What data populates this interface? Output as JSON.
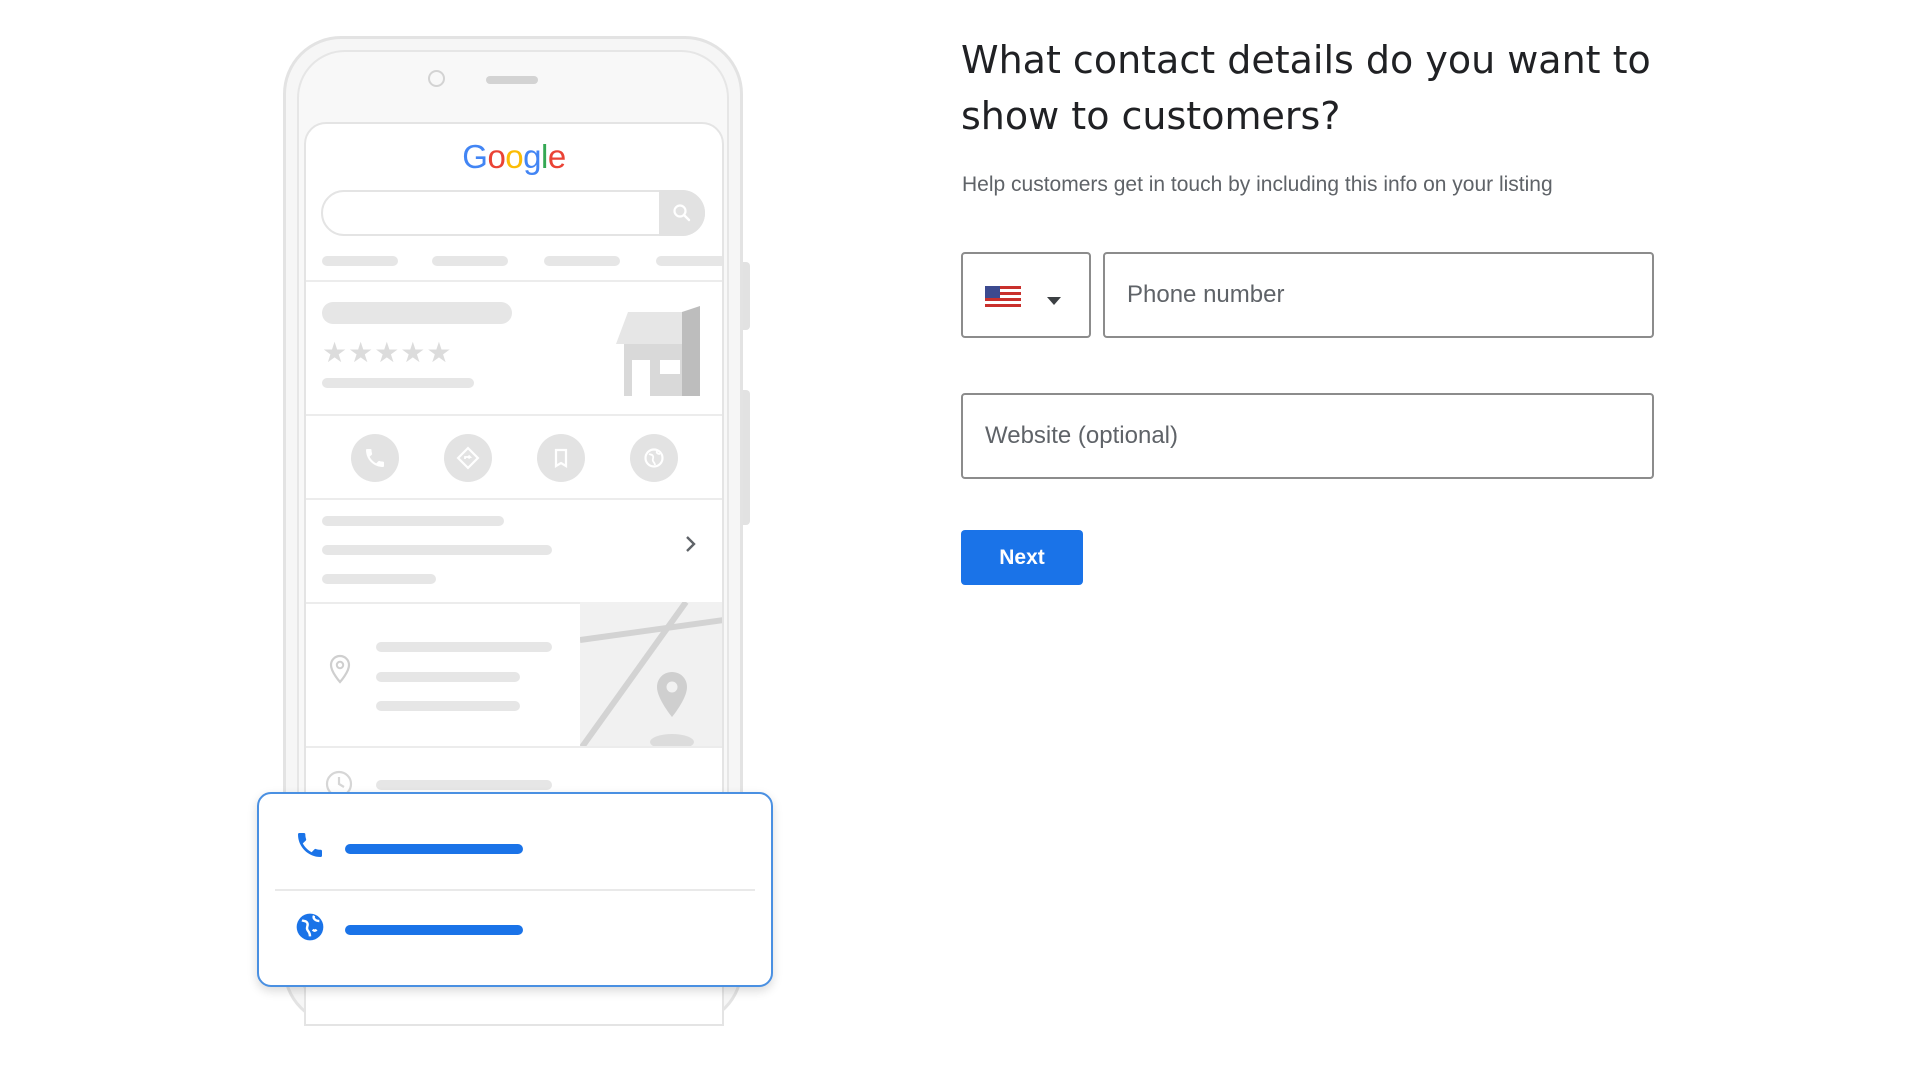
{
  "form": {
    "title": "What contact details do you want to show to customers?",
    "subtitle": "Help customers get in touch by including this info on your listing",
    "country_select": {
      "flag_icon": "us-flag-icon",
      "dropdown_icon": "caret-down-icon"
    },
    "phone_placeholder": "Phone number",
    "website_placeholder": "Website (optional)",
    "next_label": "Next"
  },
  "illustration": {
    "logo_letters": [
      {
        "char": "G",
        "color": "#4285F4"
      },
      {
        "char": "o",
        "color": "#EA4335"
      },
      {
        "char": "o",
        "color": "#FBBC05"
      },
      {
        "char": "g",
        "color": "#4285F4"
      },
      {
        "char": "l",
        "color": "#34A853"
      },
      {
        "char": "e",
        "color": "#EA4335"
      }
    ],
    "rating_stars": "★★★★★",
    "action_icons": [
      "phone-icon",
      "directions-icon",
      "bookmark-icon",
      "globe-icon"
    ],
    "contact_card_icons": [
      "phone-icon",
      "globe-icon"
    ]
  },
  "colors": {
    "accent": "#1a73e8",
    "placeholder_gray": "#e6e6e6"
  }
}
